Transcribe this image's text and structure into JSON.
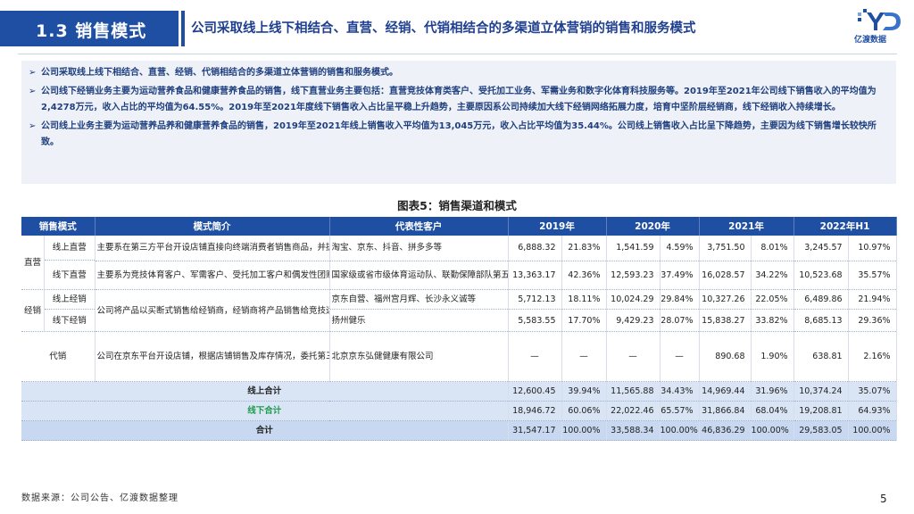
{
  "header": {
    "section": "1.3  销售模式",
    "title": "公司采取线上线下相结合、直营、经销、代销相结合的多渠道立体营销的销售和服务模式",
    "logo_text": "亿渡数据"
  },
  "bullets": [
    "公司采取线上线下相结合、直营、经销、代销相结合的多渠道立体营销的销售和服务模式。",
    "公司线下经销业务主要为运动营养食品和健康营养食品的销售，线下直营业务主要包括：直营竞技体育类客户、受托加工业务、军需业务和数字化体育科技服务等。2019年至2021年公司线下销售收入的平均值为2,4278万元，收入占比的平均值为64.55%。2019年至2021年度线下销售收入占比呈平稳上升趋势，主要原因系公司持续加大线下经销网络拓展力度，培育中坚阶层经销商，线下经销收入持续增长。",
    "公司线上业务主要为运动营养品养和健康营养食品的销售，2019年至2021年线上销售收入平均值为13,045万元，收入占比平均值为35.44%。公司线上销售收入占比呈下降趋势，主要因为线下销售增长较快所致。"
  ],
  "figure_title": "图表5：销售渠道和模式",
  "table": {
    "headers": [
      "销售模式",
      "模式简介",
      "代表性客户",
      "2019年",
      "2020年",
      "2021年",
      "2022年H1"
    ],
    "groups": {
      "direct": "直营",
      "dealer": "经销",
      "consign": "代销"
    },
    "rows": [
      {
        "sub": "线上直营",
        "desc": "主要系在第三方平台开设店铺直接向终端消费者销售商品，并提供配送及退换货等服务",
        "customer": "淘宝、京东、抖音、拼多多等",
        "vals": [
          "6,888.32",
          "21.83%",
          "1,541.59",
          "4.59%",
          "3,751.50",
          "8.01%",
          "3,245.57",
          "10.97%"
        ]
      },
      {
        "sub": "线下直营",
        "desc": "主要系为竞技体育客户、军需客户、受托加工客户和偶发性团购客户等提供运动营养、健康营养食品和数字化体育科技服务",
        "customer": "国家级或省市级体育运动队、联勤保障部队第五采购服务站、幸福能量公司等",
        "vals": [
          "13,363.17",
          "42.36%",
          "12,593.23",
          "37.49%",
          "16,028.57",
          "34.22%",
          "10,523.68",
          "35.57%"
        ]
      },
      {
        "sub": "线上经销",
        "desc": "公司将产品以买断式销售给经销商，经销商将产品销售给竞技运动人群和大众健身健康人群",
        "customer": "京东自营、福州宫月辉、长沙永义诚等",
        "vals": [
          "5,712.13",
          "18.11%",
          "10,024.29",
          "29.84%",
          "10,327.26",
          "22.05%",
          "6,489.86",
          "21.94%"
        ]
      },
      {
        "sub": "线下经销",
        "desc": "",
        "customer": "扬州健乐",
        "vals": [
          "5,583.55",
          "17.70%",
          "9,429.23",
          "28.07%",
          "15,838.27",
          "33.82%",
          "8,685.13",
          "29.36%"
        ]
      },
      {
        "sub": "",
        "desc": "公司在京东平台开设店铺，根据店铺销售及库存情况，委托第三方物流将货物运送至电商平台指定仓库，消费者下单后，由电商平台负责产品物流配送及收款，电商平台按照代销清单与公司结算",
        "customer": "北京京东弘健健康有限公司",
        "vals": [
          "—",
          "—",
          "—",
          "—",
          "890.68",
          "1.90%",
          "638.81",
          "2.16%"
        ]
      }
    ],
    "summary": [
      {
        "label": "线上合计",
        "vals": [
          "12,600.45",
          "39.94%",
          "11,565.88",
          "34.43%",
          "14,969.44",
          "31.96%",
          "10,374.24",
          "35.07%"
        ]
      },
      {
        "label": "线下合计",
        "vals": [
          "18,946.72",
          "60.06%",
          "22,022.46",
          "65.57%",
          "31,866.84",
          "68.04%",
          "19,208.81",
          "64.93%"
        ]
      },
      {
        "label": "合计",
        "vals": [
          "31,547.17",
          "100.00%",
          "33,588.34",
          "100.00%",
          "46,836.29",
          "100.00%",
          "29,583.05",
          "100.00%"
        ]
      }
    ]
  },
  "source": "数据来源：公司公告、亿渡数据整理",
  "page_number": "5",
  "colors": {
    "primary": "#1f4fa3",
    "bullet_bg": "#eef2f8",
    "summary_bg": "#d9e5f5",
    "offline_total": "#1a9a4a"
  }
}
